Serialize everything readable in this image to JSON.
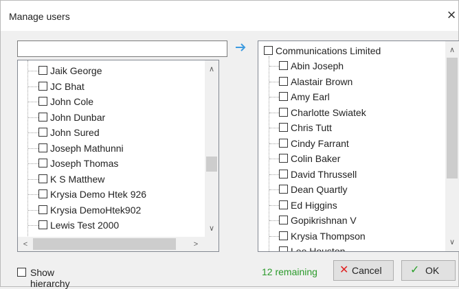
{
  "dialog": {
    "title": "Manage users",
    "close_glyph": "×"
  },
  "search": {
    "value": "",
    "placeholder": ""
  },
  "transfer_arrow_icon": "right-arrow-icon",
  "left_list": {
    "items": [
      "Jaik George",
      "JC Bhat",
      "John Cole",
      "John Dunbar",
      "John Sured",
      "Joseph Mathunni",
      "Joseph Thomas",
      "K S Matthew",
      "Krysia Demo Htek 926",
      "Krysia DemoHtek902",
      "Lewis Test 2000"
    ]
  },
  "right_list": {
    "root": "Communications Limited",
    "items": [
      "Abin Joseph",
      "Alastair Brown",
      "Amy Earl",
      "Charlotte Swiatek",
      "Chris Tutt",
      "Cindy Farrant",
      "Colin Baker",
      "David Thrussell",
      "Dean Quartly",
      "Ed Higgins",
      "Gopikrishnan V",
      "Krysia Thompson",
      "Lee Houston"
    ]
  },
  "footer": {
    "show_hierarchy_label": "Show hierarchy",
    "remaining_text": "12 remaining",
    "cancel_label": "Cancel",
    "ok_label": "OK"
  },
  "colors": {
    "remaining": "#2a9a2a",
    "cancel_icon": "#e02020",
    "ok_icon": "#2aa02a",
    "arrow": "#3d9be0"
  }
}
